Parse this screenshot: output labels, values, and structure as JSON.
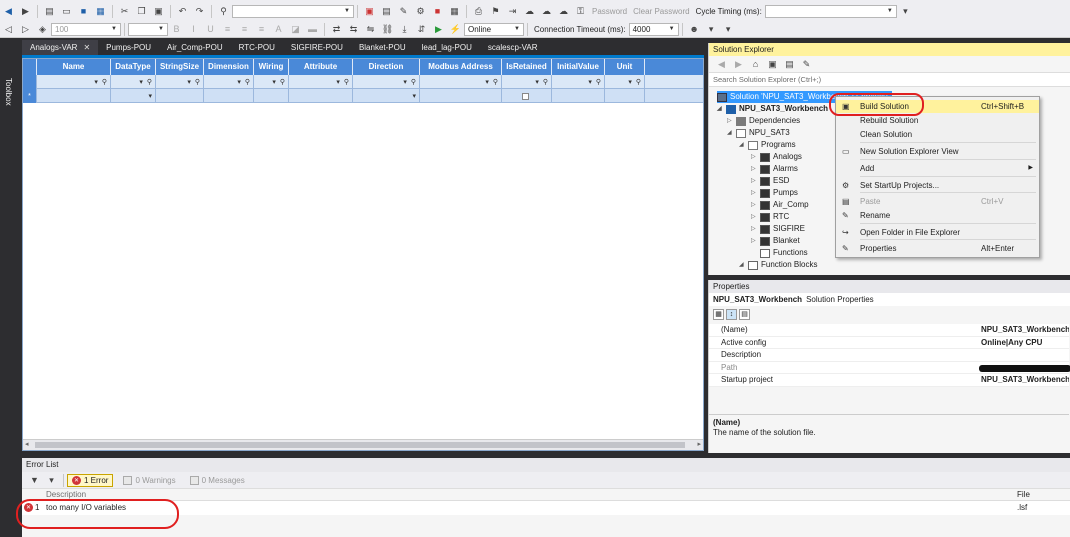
{
  "toolbar": {
    "zoom_value": "100",
    "online_value": "Online",
    "password_label": "Password",
    "clear_password_label": "Clear Password",
    "cycle_timing_label": "Cycle Timing (ms):",
    "connection_timeout_label": "Connection Timeout (ms):",
    "connection_timeout_value": "4000"
  },
  "toolbox": {
    "label": "Toolbox"
  },
  "doc_tabs": [
    {
      "label": "Analogs-VAR",
      "active": true
    },
    {
      "label": "Pumps-POU"
    },
    {
      "label": "Air_Comp-POU"
    },
    {
      "label": "RTC-POU"
    },
    {
      "label": "SIGFIRE-POU"
    },
    {
      "label": "Blanket-POU"
    },
    {
      "label": "lead_lag-POU"
    },
    {
      "label": "scalescp-VAR"
    }
  ],
  "grid": {
    "columns": [
      "Name",
      "DataType",
      "StringSize",
      "Dimension",
      "Wiring",
      "Attribute",
      "Direction",
      "Modbus Address",
      "IsRetained",
      "InitialValue",
      "Unit"
    ],
    "new_row_marker": "*"
  },
  "solution_explorer": {
    "title": "Solution Explorer",
    "search_placeholder": "Search Solution Explorer (Ctrl+;)",
    "tree": {
      "solution": "Solution 'NPU_SAT3_Workbench' (1 project)",
      "project": "NPU_SAT3_Workbench",
      "dependencies": "Dependencies",
      "folder": "NPU_SAT3",
      "programs": "Programs",
      "program_items": [
        "Analogs",
        "Alarms",
        "ESD",
        "Pumps",
        "Air_Comp",
        "RTC",
        "SIGFIRE",
        "Blanket"
      ],
      "functions": "Functions",
      "function_blocks": "Function Blocks"
    }
  },
  "context_menu": {
    "items": [
      {
        "label": "Build Solution",
        "shortcut": "Ctrl+Shift+B",
        "highlighted": true,
        "icon": "build-icon"
      },
      {
        "label": "Rebuild Solution",
        "shortcut": ""
      },
      {
        "label": "Clean Solution",
        "shortcut": ""
      },
      {
        "label": "New Solution Explorer View",
        "shortcut": "",
        "icon": "new-view-icon"
      },
      {
        "label": "Add",
        "shortcut": "",
        "submenu": true
      },
      {
        "label": "Set StartUp Projects...",
        "shortcut": "",
        "icon": "gear-icon"
      },
      {
        "label": "Paste",
        "shortcut": "Ctrl+V",
        "disabled": true,
        "icon": "paste-icon"
      },
      {
        "label": "Rename",
        "shortcut": "",
        "icon": "rename-icon"
      },
      {
        "label": "Open Folder in File Explorer",
        "shortcut": "",
        "icon": "open-folder-icon"
      },
      {
        "label": "Properties",
        "shortcut": "Alt+Enter",
        "icon": "wrench-icon"
      }
    ]
  },
  "properties": {
    "title": "Properties",
    "object_name": "NPU_SAT3_Workbench",
    "object_type": "Solution Properties",
    "rows": [
      {
        "key": "(Name)",
        "value": "NPU_SAT3_Workbench"
      },
      {
        "key": "Active config",
        "value": "Online|Any CPU"
      },
      {
        "key": "Description",
        "value": ""
      },
      {
        "key": "Path",
        "value": "",
        "redacted": true,
        "disabled": true
      },
      {
        "key": "Startup project",
        "value": "NPU_SAT3_Workbench"
      }
    ],
    "desc_title": "(Name)",
    "desc_text": "The name of the solution file."
  },
  "error_list": {
    "title": "Error List",
    "errors_filter": "1 Error",
    "warnings_filter": "0 Warnings",
    "messages_filter": "0 Messages",
    "col_description": "Description",
    "col_file": "File",
    "rows": [
      {
        "num": "1",
        "description": "too many I/O variables",
        "file": ".lsf"
      }
    ]
  },
  "colors": {
    "accent": "#007acc",
    "grid_header": "#4a89d8",
    "highlight": "#fff29d",
    "annotation": "#e02020"
  }
}
